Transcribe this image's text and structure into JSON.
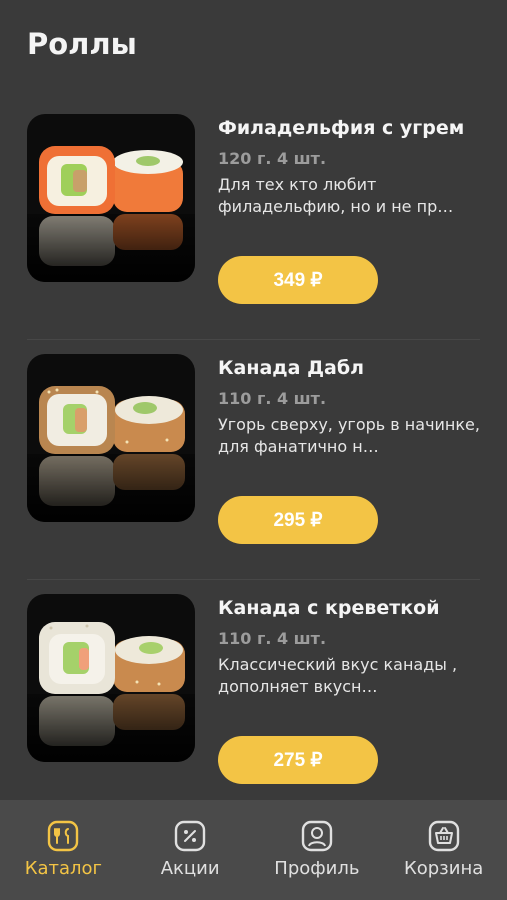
{
  "page": {
    "title": "Роллы"
  },
  "products": [
    {
      "name": "Филадельфия с угрем",
      "weight": "120 г. 4 шт.",
      "description": "Для тех кто любит филадельфию, но и не пр…",
      "price": "349 ₽",
      "image": "sushi-salmon-roll"
    },
    {
      "name": "Канада Дабл",
      "weight": "110 г. 4 шт.",
      "description": "Угорь сверху, угорь в начинке, для фанатично н…",
      "price": "295 ₽",
      "image": "sushi-sesame-roll"
    },
    {
      "name": "Канада с креветкой",
      "weight": "110 г. 4 шт.",
      "description": "Классический вкус канады , дополняет вкусн…",
      "price": "275 ₽",
      "image": "sushi-sesame-roll"
    }
  ],
  "tabbar": {
    "tabs": [
      {
        "label": "Каталог",
        "icon": "catalog-icon",
        "active": true
      },
      {
        "label": "Акции",
        "icon": "discount-icon",
        "active": false
      },
      {
        "label": "Профиль",
        "icon": "profile-icon",
        "active": false
      },
      {
        "label": "Корзина",
        "icon": "cart-icon",
        "active": false
      }
    ]
  },
  "colors": {
    "accent": "#f3c445",
    "background": "#3a3a3a",
    "tabbar": "#4a4a4a"
  }
}
